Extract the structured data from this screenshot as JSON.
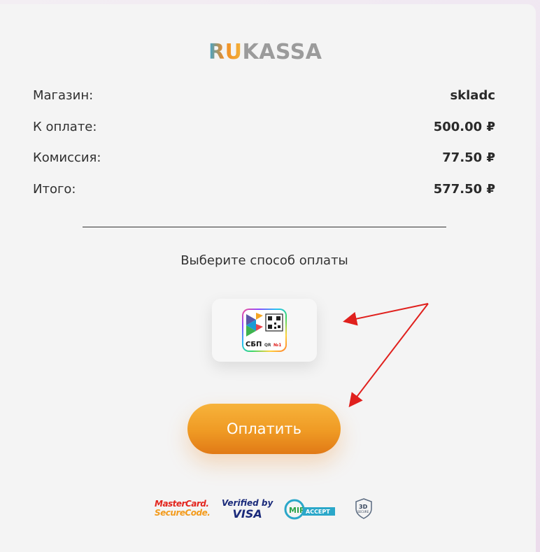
{
  "brand": {
    "logo_ru": "RU",
    "logo_kassa": "KASSA"
  },
  "summary": [
    {
      "label": "Магазин:",
      "value": "skladc"
    },
    {
      "label": "К оплате:",
      "value": "500.00 ₽"
    },
    {
      "label": "Комиссия:",
      "value": "77.50 ₽"
    },
    {
      "label": "Итого:",
      "value": "577.50 ₽"
    }
  ],
  "payment": {
    "choose_label": "Выберите способ оплаты",
    "method": {
      "name": "СБП",
      "badge_qr": "QR",
      "badge_num": "№1"
    },
    "pay_button": "Оплатить"
  },
  "footer": {
    "mastercard_line1": "MasterCard.",
    "mastercard_line2": "SecureCode.",
    "visa_line1": "Verified by",
    "visa_line2": "VISA",
    "mir_text": "MIR",
    "mir_accept": "ACCEPT",
    "secure_3d": "3D",
    "secure_3d_sub": "SECURE"
  },
  "colors": {
    "accent": "#ef9a24",
    "arrow": "#e0201d",
    "text": "#2b2b2b"
  }
}
